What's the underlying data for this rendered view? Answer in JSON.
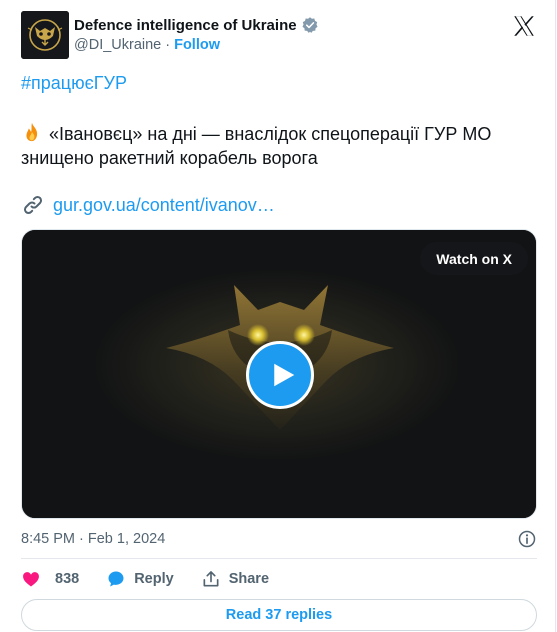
{
  "author": {
    "display_name": "Defence intelligence of Ukraine",
    "handle": "@DI_Ukraine",
    "separator": "·",
    "follow_label": "Follow",
    "verified": true,
    "avatar_icon": "owl-emblem-icon",
    "avatar_colors": {
      "background": "#15171a",
      "emblem": "#c9a64a"
    }
  },
  "platform_logo": "x-logo-icon",
  "tweet": {
    "hashtag": "#працюєГУР",
    "emoji_icon": "fire-icon",
    "text": "«Івановєц» на дні — внаслідок спецоперації ГУР МО  знищено ракетний корабель ворога",
    "link_text": "gur.gov.ua/content/ivanov…",
    "link_icon": "link-icon"
  },
  "media": {
    "watch_label": "Watch on X",
    "play_icon": "play-icon",
    "type": "video"
  },
  "meta": {
    "timestamp": "8:45 PM · Feb 1, 2024",
    "info_icon": "info-icon"
  },
  "actions": {
    "like_count": "838",
    "reply_label": "Reply",
    "share_label": "Share"
  },
  "read_replies_label": "Read 37 replies",
  "colors": {
    "accent": "#1d9bf0",
    "like": "#f91880",
    "secondary_text": "#536471",
    "primary_text": "#0f1419"
  }
}
